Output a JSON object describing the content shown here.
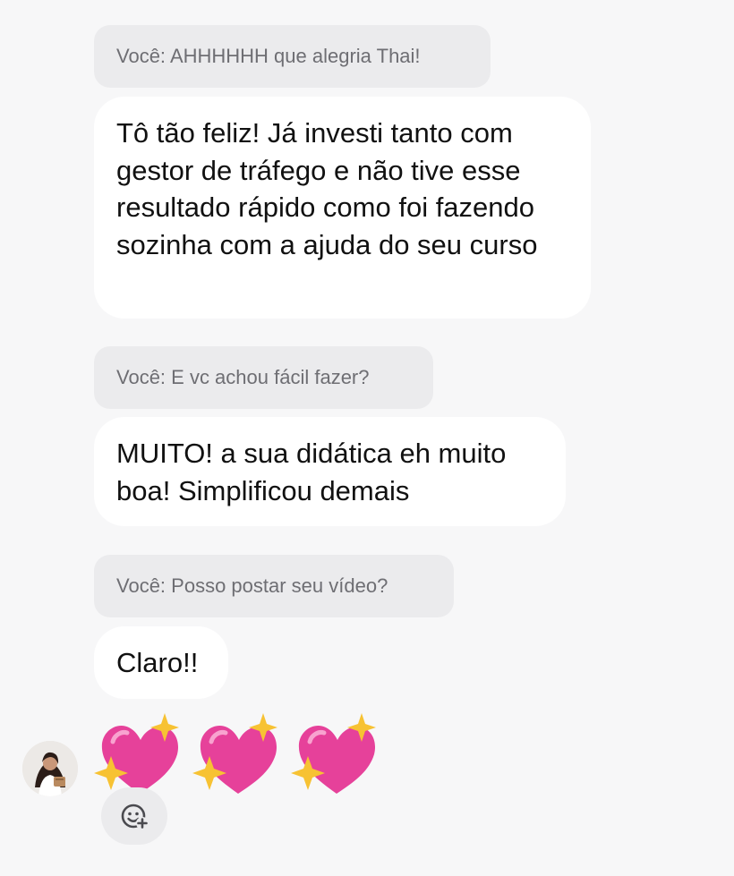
{
  "messages": [
    {
      "type": "reply-quote",
      "text": "Você: AHHHHHH que alegria Thai!"
    },
    {
      "type": "received",
      "text": "Tô tão feliz! Já investi tanto com gestor de tráfego e não tive esse resultado rápido como foi fazendo sozinha com a ajuda do seu curso"
    },
    {
      "type": "reply-quote",
      "text": "Você: E vc achou fácil fazer?"
    },
    {
      "type": "received",
      "text": "MUITO! a sua didática eh muito boa! Simplificou demais"
    },
    {
      "type": "reply-quote",
      "text": "Você: Posso postar seu vídeo?"
    },
    {
      "type": "received",
      "text": "Claro!!"
    }
  ],
  "emoji_message": {
    "emojis": [
      "sparkling-heart",
      "sparkling-heart",
      "sparkling-heart"
    ]
  },
  "contact": {
    "avatar_icon": "contact-avatar"
  },
  "react_button": {
    "icon": "add-reaction-icon"
  },
  "colors": {
    "background": "#f7f7f8",
    "received_bubble": "#ffffff",
    "reply_quote_bubble": "#ebebed",
    "heart_pink": "#e6419a",
    "sparkle_yellow": "#f7c233"
  }
}
